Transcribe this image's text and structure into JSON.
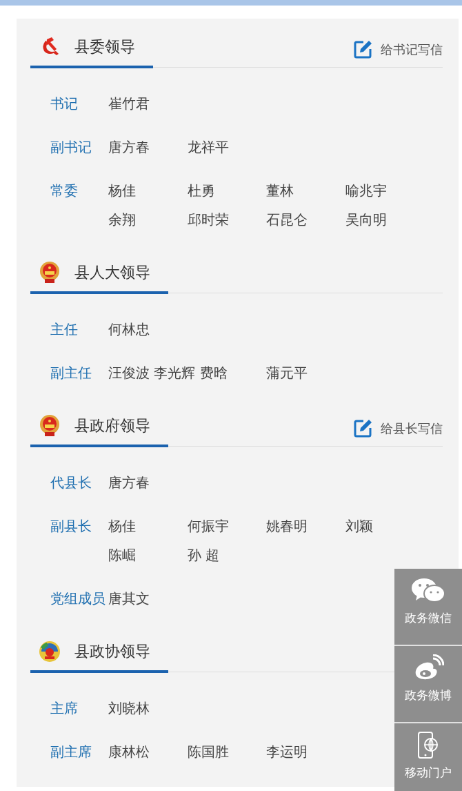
{
  "sections": [
    {
      "kind": "party",
      "title": "县委领导",
      "letter_link": "给书记写信",
      "rows": [
        {
          "role": "书记",
          "names": [
            {
              "name": "崔竹君"
            }
          ]
        },
        {
          "role": "副书记",
          "names": [
            {
              "name": "唐方春"
            },
            {
              "name": "龙祥平"
            }
          ]
        },
        {
          "role": "常委",
          "names": [
            {
              "name": "杨佳"
            },
            {
              "name": "杜勇"
            },
            {
              "name": "董林"
            },
            {
              "name": "喻兆宇"
            },
            {
              "name": "余翔"
            },
            {
              "name": "邱时荣"
            },
            {
              "name": "石昆仑"
            },
            {
              "name": "吴向明"
            }
          ]
        }
      ]
    },
    {
      "kind": "state",
      "title": "县人大领导",
      "rows": [
        {
          "role": "主任",
          "names": [
            {
              "name": "何林忠"
            }
          ]
        },
        {
          "role": "副主任",
          "names": [
            {
              "name": "汪俊波 李光辉 费晗",
              "kind": "wide"
            },
            {
              "name": "蒲元平"
            }
          ]
        }
      ]
    },
    {
      "kind": "state",
      "title": "县政府领导",
      "letter_link": "给县长写信",
      "rows": [
        {
          "role": "代县长",
          "names": [
            {
              "name": "唐方春"
            }
          ]
        },
        {
          "role": "副县长",
          "names": [
            {
              "name": "杨佳"
            },
            {
              "name": "何振宇"
            },
            {
              "name": "姚春明"
            },
            {
              "name": "刘颖"
            },
            {
              "name": "陈崛"
            },
            {
              "name": "孙 超"
            }
          ]
        },
        {
          "role": "党组成员",
          "names": [
            {
              "name": "唐其文"
            }
          ]
        }
      ]
    },
    {
      "kind": "cppcc",
      "title": "县政协领导",
      "rows": [
        {
          "role": "主席",
          "names": [
            {
              "name": "刘晓林"
            }
          ]
        },
        {
          "role": "副主席",
          "names": [
            {
              "name": "康林松"
            },
            {
              "name": "陈国胜"
            },
            {
              "name": "李运明"
            }
          ]
        }
      ]
    }
  ],
  "side_bar": [
    {
      "kind": "wechat",
      "label": "政务微信"
    },
    {
      "kind": "weibo",
      "label": "政务微博"
    },
    {
      "kind": "mobile",
      "label": "移动门户"
    }
  ]
}
